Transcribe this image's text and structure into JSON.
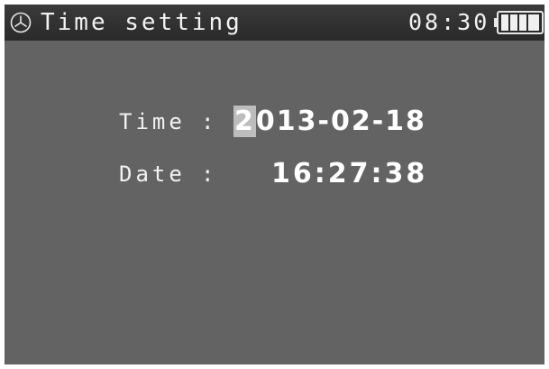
{
  "header": {
    "title": "Time setting",
    "clock_display": "08:30",
    "clock_icon": "clock-icon",
    "battery_icon": "battery-icon"
  },
  "fields": {
    "time": {
      "label": "Time",
      "separator": ":",
      "value_cursor": "2",
      "value_rest": "013-02-18"
    },
    "date": {
      "label": "Date",
      "separator": ":",
      "value": "16:27:38"
    }
  },
  "colors": {
    "background": "#636363",
    "title_bar": "#2e2e2e",
    "text": "#f2f2f2",
    "cursor_highlight": "#bdbdbd"
  }
}
